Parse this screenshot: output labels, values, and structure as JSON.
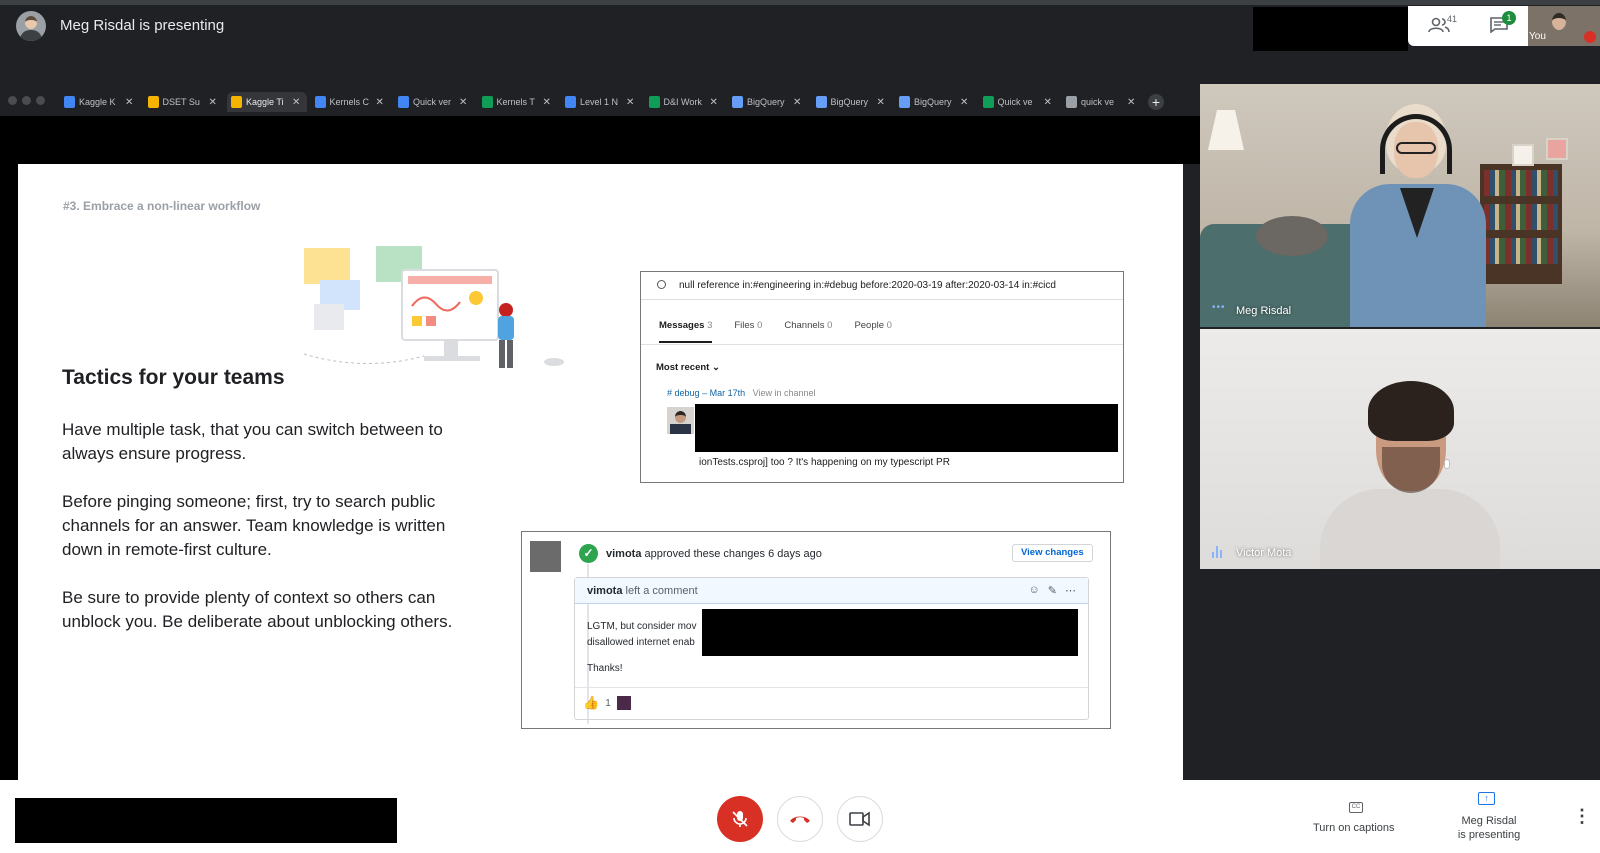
{
  "topbar": {
    "presenting_text": "Meg Risdal is presenting",
    "people_count": "41",
    "chat_badge": "1",
    "self_label": "You"
  },
  "browser_tabs": [
    {
      "label": "Kaggle K",
      "color": "#4285f4",
      "active": false
    },
    {
      "label": "DSET Su",
      "color": "#f4b400",
      "active": false
    },
    {
      "label": "Kaggle Ti",
      "color": "#f4b400",
      "active": true
    },
    {
      "label": "Kernels C",
      "color": "#4285f4",
      "active": false
    },
    {
      "label": "Quick ver",
      "color": "#4285f4",
      "active": false
    },
    {
      "label": "Kernels T",
      "color": "#0f9d58",
      "active": false
    },
    {
      "label": "Level 1 N",
      "color": "#4285f4",
      "active": false
    },
    {
      "label": "D&I Work",
      "color": "#0f9d58",
      "active": false
    },
    {
      "label": "BigQuery",
      "color": "#669df6",
      "active": false
    },
    {
      "label": "BigQuery",
      "color": "#669df6",
      "active": false
    },
    {
      "label": "BigQuery",
      "color": "#669df6",
      "active": false
    },
    {
      "label": "Quick ve",
      "color": "#0f9d58",
      "active": false
    },
    {
      "label": "quick ve",
      "color": "#9aa0a6",
      "active": false
    }
  ],
  "slide": {
    "heading": "#3. Embrace a non-linear workflow",
    "title": "Tactics for your teams",
    "paragraphs": [
      "Have multiple task, that you can switch between to always ensure progress.",
      "Before pinging someone; first, try to search public channels for an answer. Team knowledge is written down in remote-first culture.",
      "Be sure to provide plenty of context so others can unblock you. Be deliberate about unblocking others."
    ],
    "slack": {
      "query": "null reference in:#engineering in:#debug before:2020-03-19 after:2020-03-14 in:#cicd",
      "tabs": [
        {
          "label": "Messages",
          "count": "3"
        },
        {
          "label": "Files",
          "count": "0"
        },
        {
          "label": "Channels",
          "count": "0"
        },
        {
          "label": "People",
          "count": "0"
        }
      ],
      "sort": "Most recent",
      "result_channel": "# debug",
      "result_sep": "–",
      "result_date": "Mar 17th",
      "result_link": "View in channel",
      "result_text": "ionTests.csproj] too ? It's happening on my typescript PR"
    },
    "github": {
      "user": "vimota",
      "approve_text": "approved these changes 6 days ago",
      "view_changes": "View changes",
      "comment_action": "left a comment",
      "body_line1": "LGTM, but consider mov",
      "body_line2": "disallowed internet enab",
      "thanks": "Thanks!",
      "reaction_count": "1"
    }
  },
  "participants": [
    {
      "name": "Meg Risdal"
    },
    {
      "name": "Victor Mota"
    }
  ],
  "bottombar": {
    "captions_label": "Turn on captions",
    "present_label_1": "Meg Risdal",
    "present_label_2": "is presenting"
  },
  "colors": {
    "mic_off_red": "#d93025",
    "accent_blue": "#1a73e8",
    "approve_green": "#2ea44f"
  },
  "icons": [
    "people-icon",
    "chat-icon",
    "search-icon",
    "mic-off-icon",
    "hang-up-icon",
    "camera-icon",
    "captions-icon",
    "present-icon",
    "more-vert-icon"
  ]
}
